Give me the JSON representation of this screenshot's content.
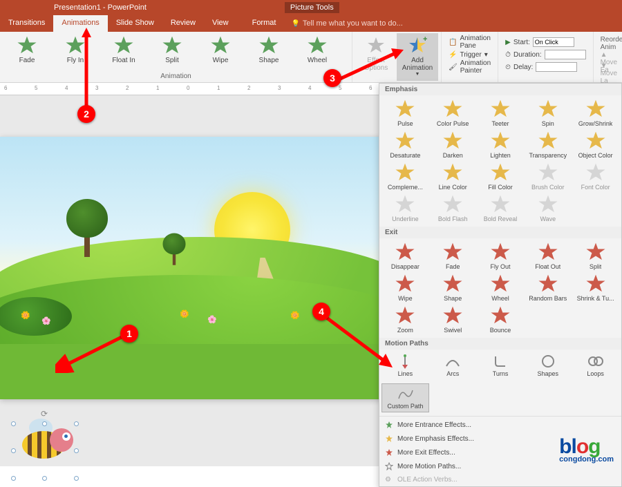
{
  "title": "Presentation1 - PowerPoint",
  "picture_tools": "Picture Tools",
  "tabs": {
    "transitions": "Transitions",
    "animations": "Animations",
    "slideshow": "Slide Show",
    "review": "Review",
    "view": "View",
    "format": "Format"
  },
  "tell_me": "Tell me what you want to do...",
  "ribbon": {
    "anim_group": "Animation",
    "effects": [
      "Fade",
      "Fly In",
      "Float In",
      "Split",
      "Wipe",
      "Shape",
      "Wheel"
    ],
    "effect_options": "Effect\nOptions",
    "add_animation": "Add\nAnimation",
    "anim_pane": "Animation Pane",
    "trigger": "Trigger",
    "painter": "Animation Painter",
    "timing": {
      "start_lbl": "Start:",
      "start_val": "On Click",
      "duration_lbl": "Duration:",
      "delay_lbl": "Delay:"
    },
    "reorder": {
      "hdr": "Reorder Anim",
      "earlier": "▲ Move Ea",
      "later": "▼ Move La"
    }
  },
  "dropdown": {
    "emphasis_hdr": "Emphasis",
    "emphasis": [
      "Pulse",
      "Color Pulse",
      "Teeter",
      "Spin",
      "Grow/Shrink",
      "Desaturate",
      "Darken",
      "Lighten",
      "Transparency",
      "Object Color",
      "Compleme...",
      "Line Color",
      "Fill Color",
      "Brush Color",
      "Font Color",
      "Underline",
      "Bold Flash",
      "Bold Reveal",
      "Wave"
    ],
    "exit_hdr": "Exit",
    "exit": [
      "Disappear",
      "Fade",
      "Fly Out",
      "Float Out",
      "Split",
      "Wipe",
      "Shape",
      "Wheel",
      "Random Bars",
      "Shrink & Tu...",
      "Zoom",
      "Swivel",
      "Bounce"
    ],
    "motion_hdr": "Motion Paths",
    "motion": [
      "Lines",
      "Arcs",
      "Turns",
      "Shapes",
      "Loops"
    ],
    "custom_path": "Custom Path",
    "footer": {
      "entrance": "More Entrance Effects...",
      "emphasis": "More Emphasis Effects...",
      "exit": "More Exit Effects...",
      "motion": "More Motion Paths...",
      "ole": "OLE Action Verbs..."
    }
  },
  "markers": {
    "m1": "1",
    "m2": "2",
    "m3": "3",
    "m4": "4"
  },
  "watermark": {
    "main": "blog",
    "sub": "congdong.com"
  }
}
